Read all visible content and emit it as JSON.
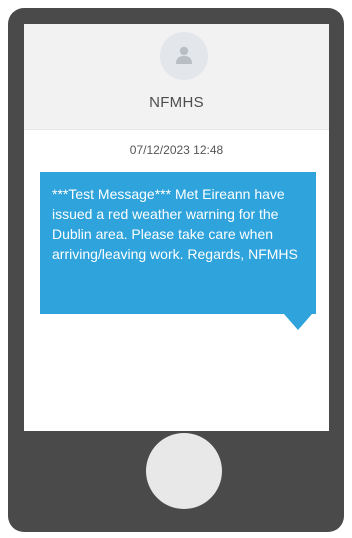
{
  "contact": {
    "name": "NFMHS",
    "avatar_icon": "user-icon"
  },
  "message": {
    "timestamp": "07/12/2023 12:48",
    "body": "***Test Message*** Met Eireann have issued a red weather warning for the Dublin area. Please take care when arriving/leaving work. Regards, NFMHS"
  },
  "colors": {
    "bubble": "#2ea3dc",
    "phone_frame": "#4a4a4a",
    "header_bg": "#f2f2f2"
  }
}
